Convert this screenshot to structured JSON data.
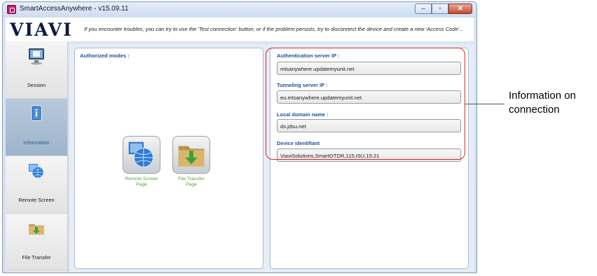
{
  "window": {
    "title": "SmartAccessAnywhere - v15.09.11"
  },
  "window_buttons": {
    "minimize": "–",
    "maximize": "▫",
    "close": "✕"
  },
  "header": {
    "logo": "VIAVI",
    "message": "If you encounter troubles, you can try to use the 'Test connection' button, or if the problem persists, try to disconnect the device and create a new 'Access Code'..."
  },
  "sidebar": {
    "items": [
      {
        "label": "Session",
        "icon": "monitor-icon",
        "active": false
      },
      {
        "label": "Information",
        "icon": "info-icon",
        "active": true
      },
      {
        "label": "Remote Screen",
        "icon": "remote-screen-icon",
        "active": false
      },
      {
        "label": "File Transfer",
        "icon": "folder-download-icon",
        "active": false
      }
    ]
  },
  "authorized_modes": {
    "title": "Authorized modes :",
    "modes": [
      {
        "label_line1": "Remote Screen",
        "label_line2": "Page",
        "icon": "remote-screen-icon"
      },
      {
        "label_line1": "File Transfer",
        "label_line2": "Page",
        "icon": "folder-download-icon"
      }
    ]
  },
  "info": {
    "fields": [
      {
        "label": "Authentication server IP :",
        "value": "mtsanywhere.updatemyunit.net"
      },
      {
        "label": "Tunneling server IP :",
        "value": "eu.mtsanywhere.updatemyunit.net"
      },
      {
        "label": "Local domain name :",
        "value": "ds.jdsu.net"
      },
      {
        "label": "Device identifiant",
        "value": "ViaviSolutions,SmartOTDR,115,ISU,15.21"
      }
    ]
  },
  "annotation": {
    "line1": "Information on",
    "line2": "connection"
  },
  "colors": {
    "accent_label": "#1f4e9a",
    "mode_label": "#57a33c",
    "highlight": "#d12a2a"
  }
}
